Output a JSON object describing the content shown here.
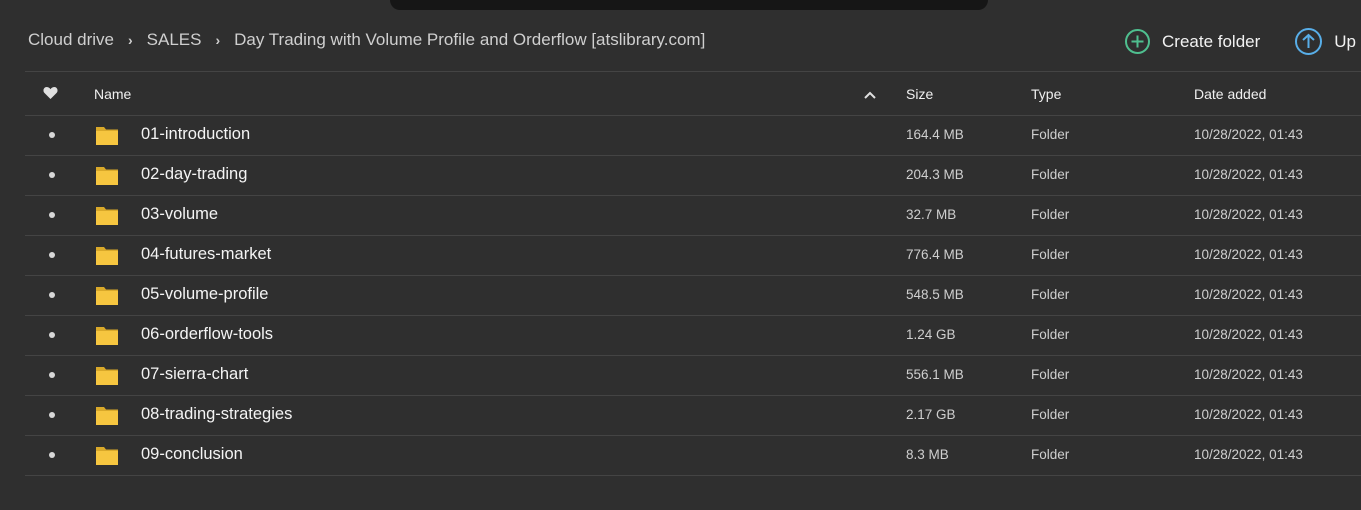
{
  "breadcrumb": {
    "items": [
      "Cloud drive",
      "SALES",
      "Day Trading with Volume Profile and Orderflow [atslibrary.com]"
    ],
    "separator": "›"
  },
  "actions": {
    "create_folder": "Create folder",
    "upload": "Up"
  },
  "table": {
    "headers": {
      "name": "Name",
      "size": "Size",
      "type": "Type",
      "date": "Date added"
    },
    "rows": [
      {
        "name": "01-introduction",
        "size": "164.4 MB",
        "type": "Folder",
        "date": "10/28/2022, 01:43"
      },
      {
        "name": "02-day-trading",
        "size": "204.3 MB",
        "type": "Folder",
        "date": "10/28/2022, 01:43"
      },
      {
        "name": "03-volume",
        "size": "32.7 MB",
        "type": "Folder",
        "date": "10/28/2022, 01:43"
      },
      {
        "name": "04-futures-market",
        "size": "776.4 MB",
        "type": "Folder",
        "date": "10/28/2022, 01:43"
      },
      {
        "name": "05-volume-profile",
        "size": "548.5 MB",
        "type": "Folder",
        "date": "10/28/2022, 01:43"
      },
      {
        "name": "06-orderflow-tools",
        "size": "1.24 GB",
        "type": "Folder",
        "date": "10/28/2022, 01:43"
      },
      {
        "name": "07-sierra-chart",
        "size": "556.1 MB",
        "type": "Folder",
        "date": "10/28/2022, 01:43"
      },
      {
        "name": "08-trading-strategies",
        "size": "2.17 GB",
        "type": "Folder",
        "date": "10/28/2022, 01:43"
      },
      {
        "name": "09-conclusion",
        "size": "8.3 MB",
        "type": "Folder",
        "date": "10/28/2022, 01:43"
      }
    ]
  },
  "colors": {
    "background": "#2f2f2f",
    "accent_green": "#4fbf8f",
    "accent_blue": "#58aee8",
    "folder_yellow": "#f6c640"
  },
  "icons": {
    "favorite_header": "heart-icon",
    "sort": "chevron-up-icon",
    "create_folder": "plus-circle-icon",
    "upload": "arrow-up-circle-icon",
    "row": "folder-icon"
  }
}
